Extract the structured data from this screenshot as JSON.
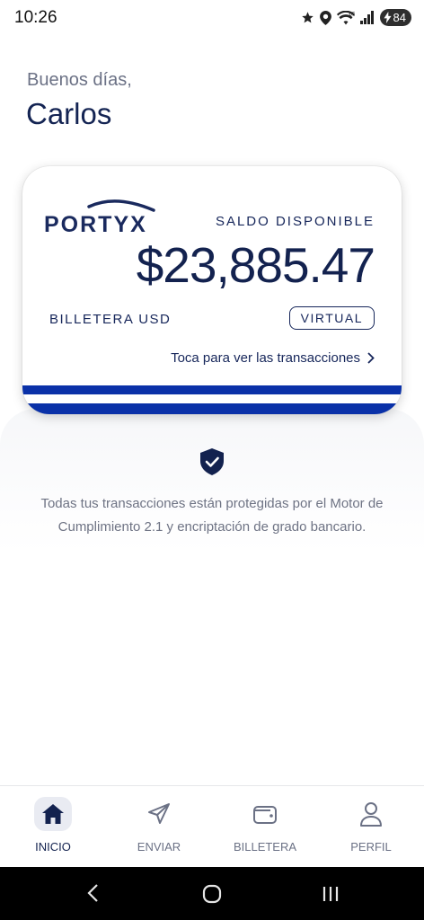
{
  "status_bar": {
    "time": "10:26",
    "battery": "84"
  },
  "greeting": "Buenos días,",
  "user_name": "Carlos",
  "card": {
    "brand": "PORTYX",
    "balance_label": "SALDO DISPONIBLE",
    "balance": "$23,885.47",
    "wallet_label": "BILLETERA USD",
    "badge": "VIRTUAL",
    "transactions_link": "Toca para ver las transacciones"
  },
  "security_note": "Todas tus transacciones están protegidas por el Motor de Cumplimiento 2.1 y encriptación de grado bancario.",
  "bottom_nav": {
    "items": [
      {
        "label": "INICIO",
        "icon": "home-icon",
        "active": true
      },
      {
        "label": "ENVIAR",
        "icon": "send-icon",
        "active": false
      },
      {
        "label": "BILLETERA",
        "icon": "wallet-icon",
        "active": false
      },
      {
        "label": "PERFIL",
        "icon": "profile-icon",
        "active": false
      }
    ]
  },
  "colors": {
    "primary": "#13224f",
    "stripe": "#0a31a8",
    "muted": "#6b7185"
  }
}
